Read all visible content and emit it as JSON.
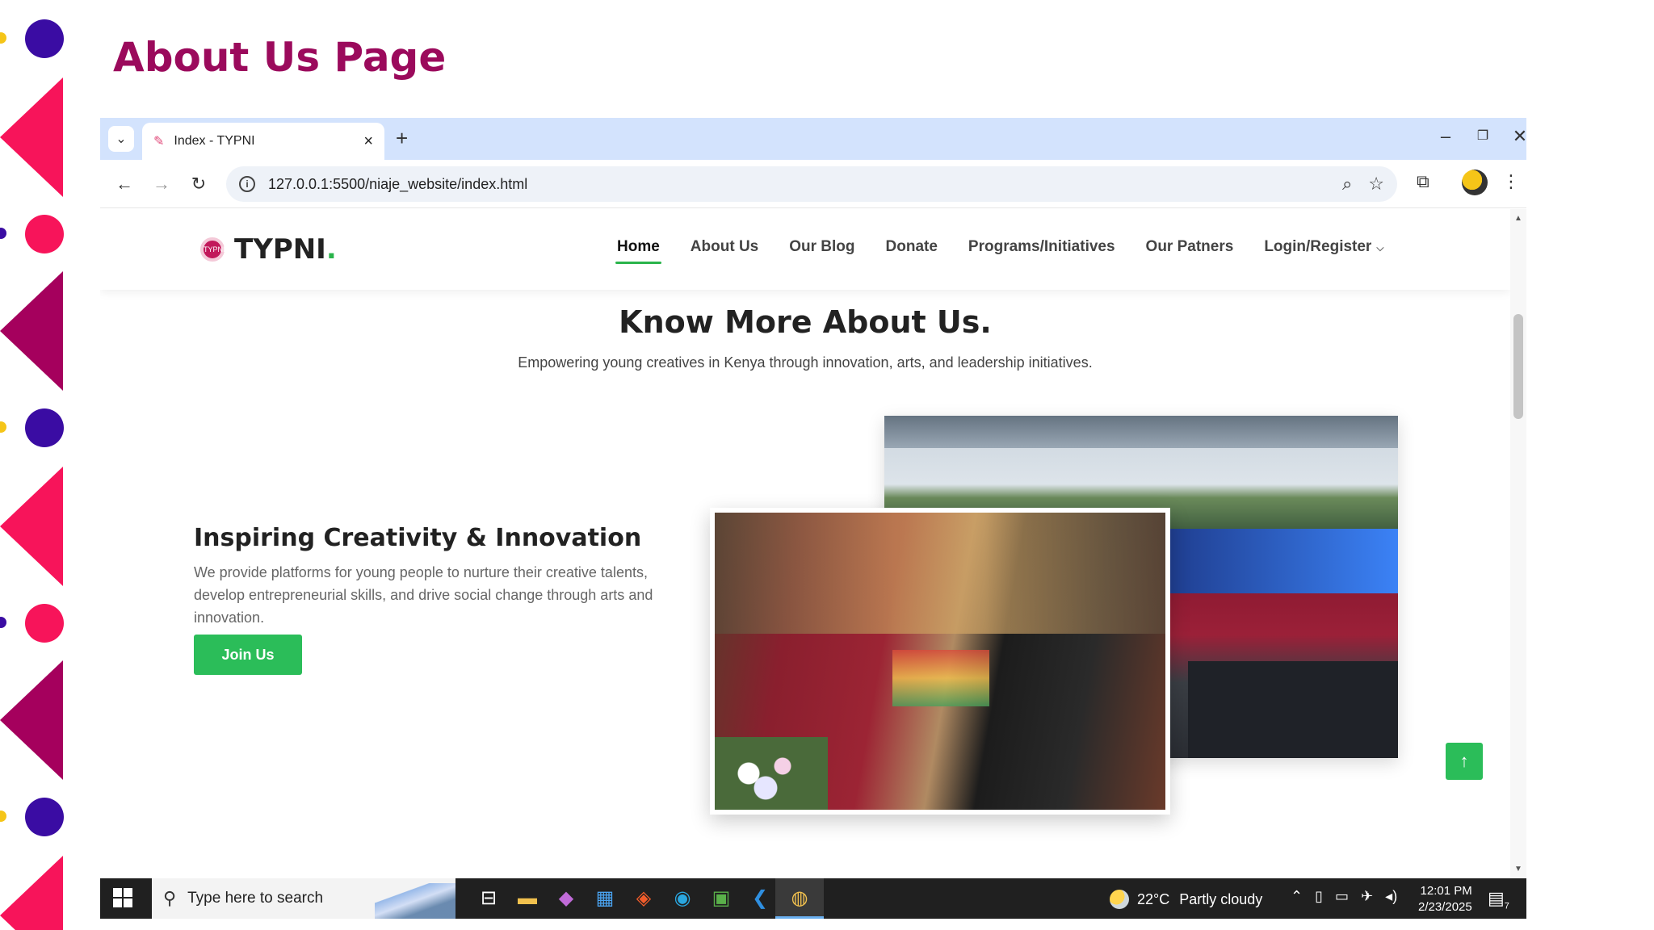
{
  "slide": {
    "title": "About Us Page"
  },
  "browser": {
    "tab": {
      "title": "Index - TYPNI",
      "favicon": "site-favicon-icon"
    },
    "url": "127.0.0.1:5500/niaje_website/index.html"
  },
  "site": {
    "logo": {
      "name": "TYPNI",
      "accent": ".",
      "badge": "TYPNI"
    },
    "nav": [
      {
        "label": "Home",
        "active": true
      },
      {
        "label": "About Us"
      },
      {
        "label": "Our Blog"
      },
      {
        "label": "Donate"
      },
      {
        "label": "Programs/Initiatives"
      },
      {
        "label": "Our Patners"
      },
      {
        "label": "Login/Register",
        "dropdown": true
      }
    ],
    "hero": {
      "title": "Know More About Us.",
      "subtitle": "Empowering young creatives in Kenya through innovation, arts, and leadership initiatives."
    },
    "feature": {
      "title": "Inspiring Creativity & Innovation",
      "text": "We provide platforms for young people to nurture their creative talents, develop entrepreneurial skills, and drive social change through arts and innovation.",
      "button": "Join Us"
    }
  },
  "taskbar": {
    "search_placeholder": "Type here to search",
    "weather": {
      "temp": "22°C",
      "condition": "Partly cloudy"
    },
    "time": "12:01 PM",
    "date": "2/23/2025",
    "notifications": "7"
  },
  "colors": {
    "title": "#9b0a5c",
    "accent_green": "#2bbd59",
    "tabbar": "#d3e3fd",
    "deco_pink": "#f7145a",
    "deco_plum": "#a5005d",
    "deco_purple": "#3a0ca3"
  }
}
